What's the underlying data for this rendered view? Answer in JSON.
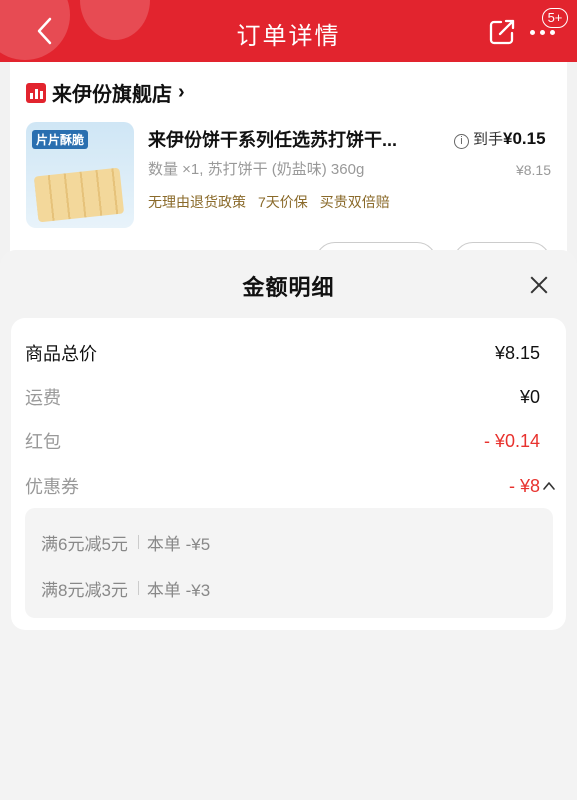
{
  "header": {
    "title": "订单详情",
    "badge": "5+",
    "back_icon": "chevron-left-icon",
    "share_icon": "share-icon",
    "more_icon": "more-dots-icon",
    "color": "#e2242e"
  },
  "store": {
    "name": "来伊份旗舰店",
    "arrow": "›"
  },
  "product": {
    "image_tag": "片片酥脆",
    "title": "来伊份饼干系列任选苏打饼干...",
    "spec": "数量 ×1, 苏打饼干 (奶盐味) 360g",
    "tags": [
      "无理由退货政策",
      "7天价保",
      "买贵双倍赔"
    ],
    "final_label": "到手",
    "final_price": "¥0.15",
    "original_price": "¥8.15"
  },
  "sheet": {
    "title": "金额明细",
    "lines": [
      {
        "label": "商品总价",
        "value": "¥8.15"
      },
      {
        "label": "运费",
        "value": "¥0"
      },
      {
        "label": "红包",
        "value": "- ¥0.14"
      },
      {
        "label": "优惠券",
        "value": "- ¥8"
      }
    ],
    "coupons": [
      {
        "name": "满6元减5元",
        "detail": "本单 -¥5"
      },
      {
        "name": "满8元减3元",
        "detail": "本单 -¥3"
      }
    ],
    "accent": "#e8322e"
  }
}
